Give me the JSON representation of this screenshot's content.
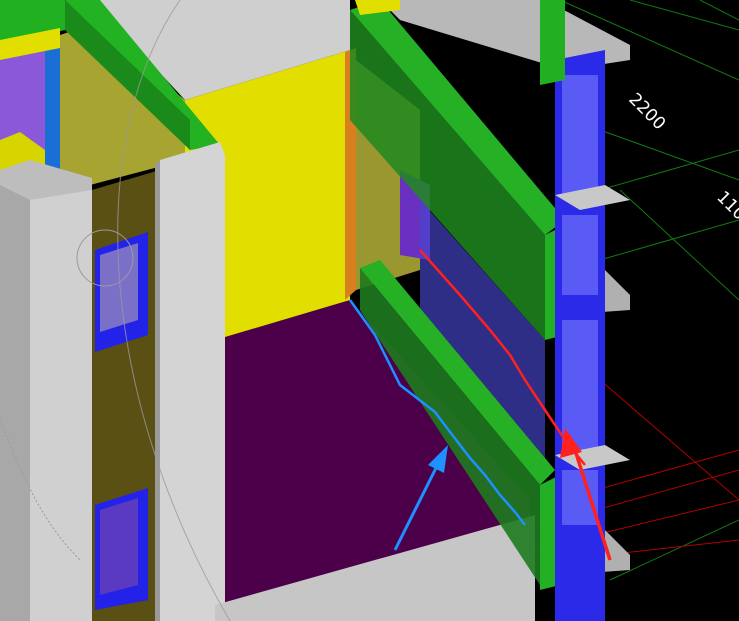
{
  "viewport": {
    "dimension_labels": [
      "2200",
      "110"
    ],
    "colors": {
      "background": "#000000",
      "wall_grey": "#c8c8c8",
      "wall_dark": "#5a5010",
      "yellow": "#e0dc00",
      "olive": "#a8a432",
      "green": "#22b022",
      "green_dark": "#1a7a1a",
      "floor_purple": "#4b0049",
      "glass_blue": "#2626e8",
      "glass_light": "#6060ff",
      "violet": "#7d4fd0",
      "orange": "#d87a1a",
      "annotation_blue": "#1e90ff",
      "annotation_red": "#ff2020",
      "grid_green": "#0f7f0f",
      "grid_red": "#b00000"
    },
    "annotations": [
      {
        "name": "blue-arrow",
        "color": "blue"
      },
      {
        "name": "red-arrow",
        "color": "red"
      }
    ]
  }
}
